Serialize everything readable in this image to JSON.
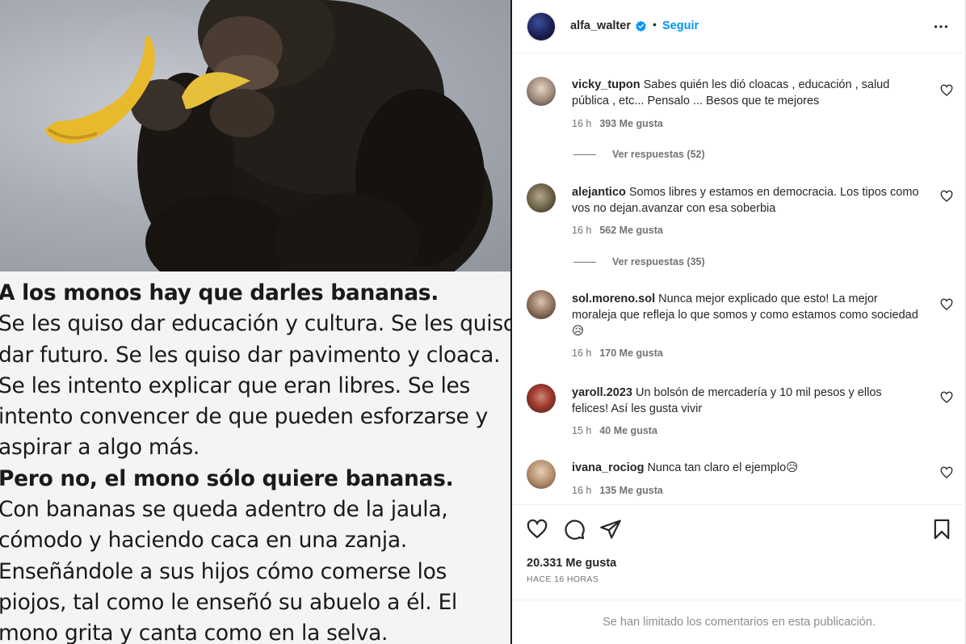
{
  "media": {
    "caption_lines": [
      {
        "text": "A los monos hay que darles bananas.",
        "bold": true
      },
      {
        "text": "Se les quiso dar educación y cultura. Se les quiso",
        "bold": false
      },
      {
        "text": "dar futuro. Se les quiso dar pavimento y cloaca.",
        "bold": false
      },
      {
        "text": "Se les intento explicar que eran libres. Se les",
        "bold": false
      },
      {
        "text": "intento convencer de que pueden esforzarse y",
        "bold": false
      },
      {
        "text": "aspirar a algo más.",
        "bold": false
      },
      {
        "text": "Pero no, el mono sólo quiere bananas.",
        "bold": true
      },
      {
        "text": "Con bananas se queda adentro de la jaula,",
        "bold": false
      },
      {
        "text": "cómodo y haciendo caca en una zanja.",
        "bold": false
      },
      {
        "text": "Enseñándole a sus hijos  cómo comerse los",
        "bold": false
      },
      {
        "text": "piojos, tal como le enseñó su abuelo a él. El",
        "bold": false
      },
      {
        "text": "mono grita y canta como en la selva.",
        "bold": false
      }
    ]
  },
  "header": {
    "username": "alfa_walter",
    "separator": "•",
    "follow_label": "Seguir",
    "avatar_icon": "profile-avatar",
    "verified_icon": "verified-badge-icon",
    "more_icon": "more-options-icon"
  },
  "comments": [
    {
      "user": "vicky_tupon",
      "text": "Sabes quién les dió cloacas , educación , salud pública , etc... Pensalo ... Besos que te mejores",
      "time": "16 h",
      "likes": "393 Me gusta",
      "replies": "Ver respuestas (52)"
    },
    {
      "user": "alejantico",
      "text": "Somos libres y estamos en democracia. Los tipos como vos no dejan.avanzar con esa soberbia",
      "time": "16 h",
      "likes": "562 Me gusta",
      "replies": "Ver respuestas (35)"
    },
    {
      "user": "sol.moreno.sol",
      "text": "Nunca mejor explicado que esto! La mejor moraleja que refleja lo que somos y como estamos como sociedad 😥",
      "time": "16 h",
      "likes": "170 Me gusta",
      "replies": ""
    },
    {
      "user": "yaroll.2023",
      "text": "Un bolsón de mercadería y 10 mil pesos y ellos felices! Así les gusta vivir",
      "time": "15 h",
      "likes": "40 Me gusta",
      "replies": ""
    },
    {
      "user": "ivana_rociog",
      "text": "Nunca tan claro el ejemplo😥",
      "time": "16 h",
      "likes": "135 Me gusta",
      "replies": ""
    }
  ],
  "actions": {
    "like_icon": "heart-icon",
    "comment_icon": "comment-icon",
    "share_icon": "send-icon",
    "save_icon": "bookmark-icon",
    "likes_count": "20.331 Me gusta",
    "posted_ago": "HACE 16 HORAS"
  },
  "footer": {
    "limited_text": "Se han limitado los comentarios en esta publicación."
  },
  "colors": {
    "accent": "#0095f6",
    "muted": "#737373",
    "text": "#262626"
  }
}
